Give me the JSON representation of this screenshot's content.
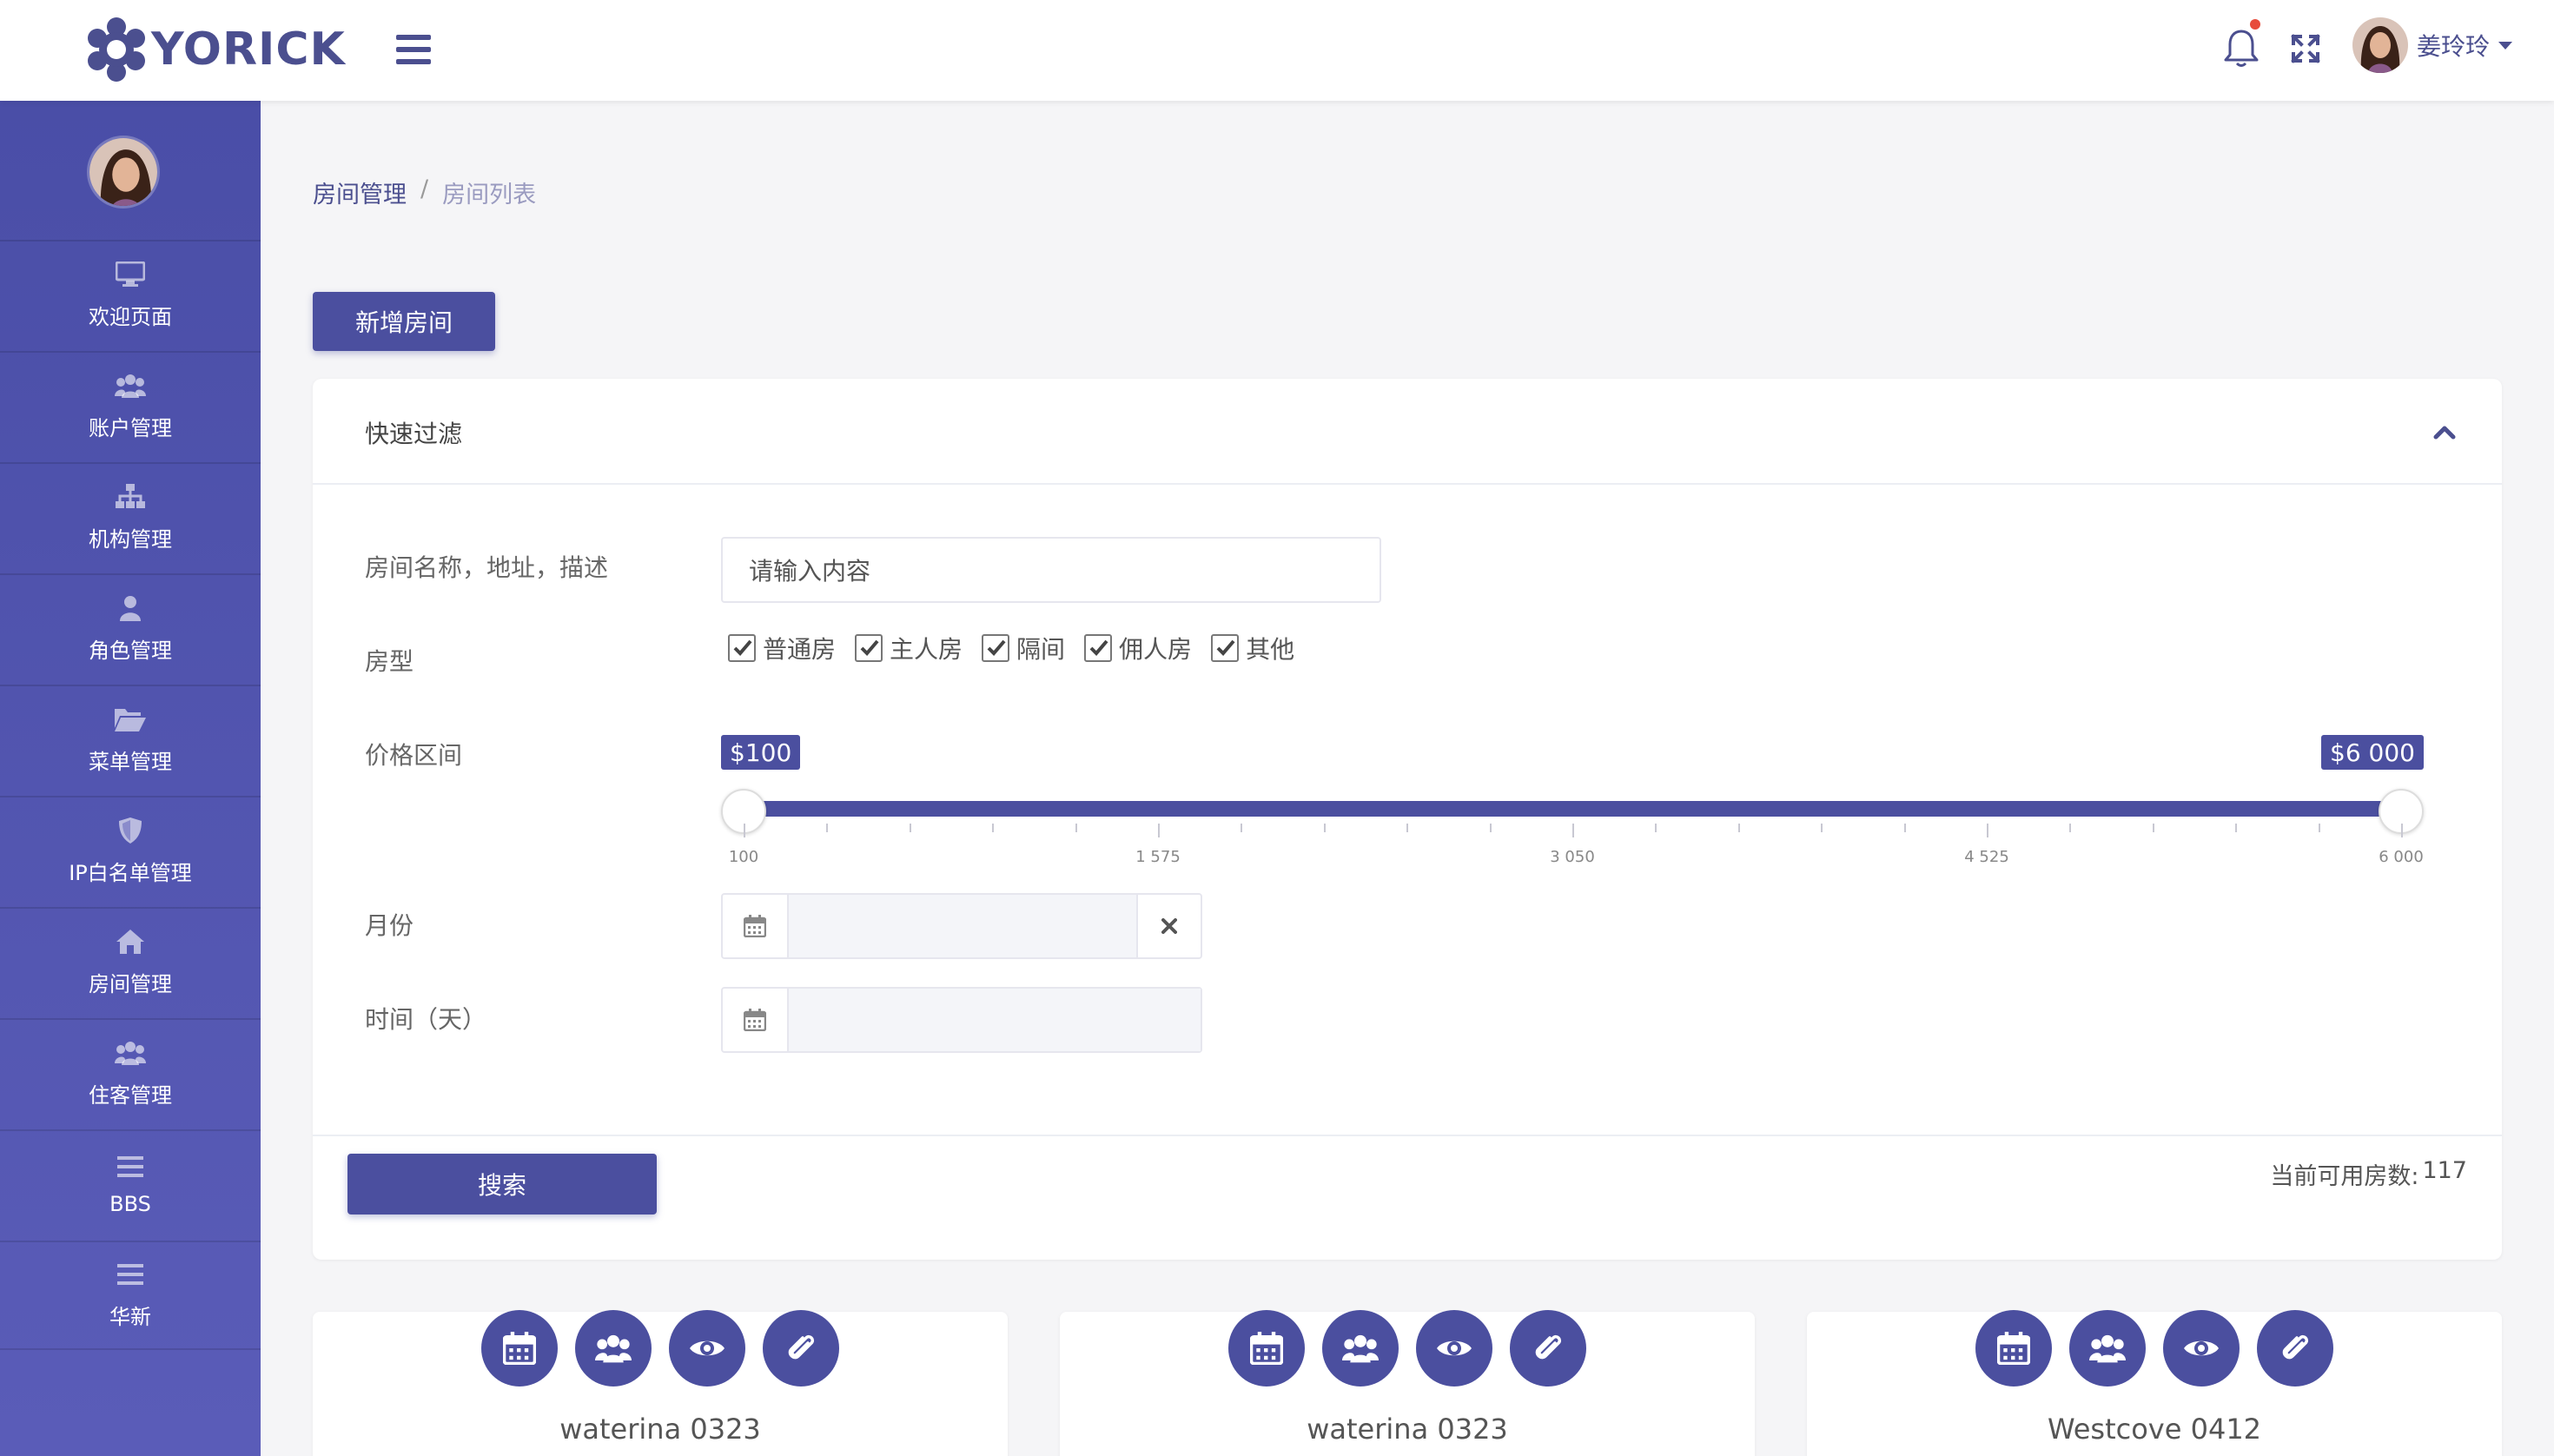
{
  "header": {
    "logo_text": "YORICK",
    "user_name": "姜玲玲"
  },
  "sidebar": {
    "items": [
      {
        "label": "欢迎页面",
        "icon": "monitor-icon"
      },
      {
        "label": "账户管理",
        "icon": "users-icon"
      },
      {
        "label": "机构管理",
        "icon": "sitemap-icon"
      },
      {
        "label": "角色管理",
        "icon": "user-icon"
      },
      {
        "label": "菜单管理",
        "icon": "folder-open-icon"
      },
      {
        "label": "IP白名单管理",
        "icon": "shield-icon"
      },
      {
        "label": "房间管理",
        "icon": "home-icon"
      },
      {
        "label": "住客管理",
        "icon": "users-icon"
      },
      {
        "label": "BBS",
        "icon": "list-icon"
      },
      {
        "label": "华新",
        "icon": "list-icon"
      }
    ]
  },
  "breadcrumb": {
    "level1": "房间管理",
    "separator": "/",
    "level2": "房间列表"
  },
  "actions": {
    "add_room": "新增房间"
  },
  "filter": {
    "title": "快速过滤",
    "name_label": "房间名称，地址，描述",
    "name_placeholder": "请输入内容",
    "type_label": "房型",
    "room_types": [
      {
        "label": "普通房",
        "checked": true
      },
      {
        "label": "主人房",
        "checked": true
      },
      {
        "label": "隔间",
        "checked": true
      },
      {
        "label": "佣人房",
        "checked": true
      },
      {
        "label": "其他",
        "checked": true
      }
    ],
    "price_label": "价格区间",
    "price_min_tag": "$100",
    "price_max_tag": "$6 000",
    "price_range": {
      "min": 100,
      "max": 6000,
      "low": 100,
      "high": 6000
    },
    "price_ticks": [
      "100",
      "1 575",
      "3 050",
      "4 525",
      "6 000"
    ],
    "month_label": "月份",
    "days_label": "时间（天）",
    "search_button": "搜索",
    "available_label": "当前可用房数:",
    "available_count": "117"
  },
  "rooms": [
    {
      "name": "waterina 0323"
    },
    {
      "name": "waterina 0323"
    },
    {
      "name": "Westcove 0412"
    }
  ],
  "colors": {
    "primary": "#4b4f9f",
    "sidebar": "#4a4ea7",
    "background": "#f5f5f7"
  }
}
